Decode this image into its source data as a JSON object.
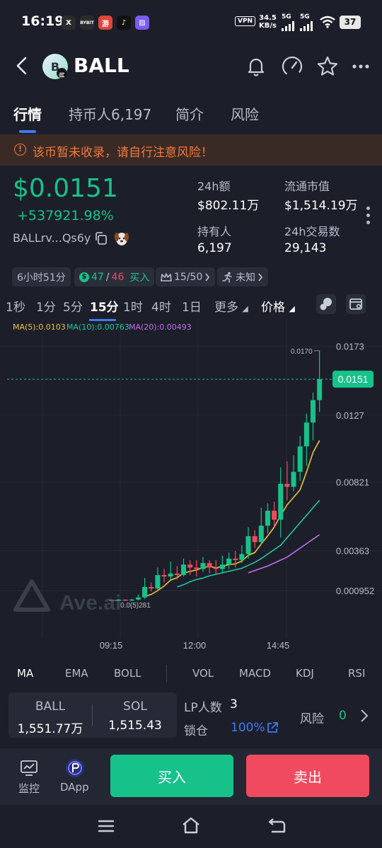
{
  "status_bar": {
    "time": "16:19",
    "apps": [
      {
        "name": "x-app-icon",
        "glyph": "X",
        "bg": "#2b2b2b"
      },
      {
        "name": "bybit-app-icon",
        "glyph": "BYBIT",
        "bg": "#2b2b2b"
      },
      {
        "name": "game-app-icon",
        "glyph": "游",
        "bg": "#e3443a"
      },
      {
        "name": "tiktok-app-icon",
        "glyph": "♪",
        "bg": "#111111"
      },
      {
        "name": "gallery-app-icon",
        "glyph": "▨",
        "bg": "#7a5cf0"
      }
    ],
    "vpn": "VPN",
    "net_speed": "34.5",
    "net_unit": "KB/s",
    "sig1": "5G",
    "sig2": "5G",
    "battery": "37"
  },
  "header": {
    "avatar_letter": "B",
    "token_name": "BALL"
  },
  "tabs": [
    {
      "label": "行情",
      "active": true
    },
    {
      "label": "持币人6,197",
      "active": false
    },
    {
      "label": "简介",
      "active": false
    },
    {
      "label": "风险",
      "active": false
    }
  ],
  "warning": {
    "icon": "!",
    "text": "该币暂未收录，请自行注意风险！"
  },
  "price": {
    "value": "$0.0151",
    "change": "+537921.98%",
    "address": "BALLrv...Qs6y"
  },
  "stats": {
    "vol24_label": "24h额",
    "vol24_value": "$802.11万",
    "mcap_label": "流通市值",
    "mcap_value": "$1,514.19万",
    "holders_label": "持有人",
    "holders_value": "6,197",
    "tx24_label": "24h交易数",
    "tx24_value": "29,143"
  },
  "pills": {
    "age": "6小时51分",
    "buy_count": "47",
    "sep": "/",
    "sell_count": "46",
    "buy_label": "买入",
    "rank": "15/50",
    "unknown": "未知"
  },
  "intervals": [
    {
      "label": "1秒",
      "active": false
    },
    {
      "label": "1分",
      "active": false
    },
    {
      "label": "5分",
      "active": false
    },
    {
      "label": "15分",
      "active": true
    },
    {
      "label": "1时",
      "active": false
    },
    {
      "label": "4时",
      "active": false
    },
    {
      "label": "1日",
      "active": false
    }
  ],
  "more_label": "更多",
  "price_label": "价格",
  "colors": {
    "up": "#17c28a",
    "down": "#f04a5e",
    "ma5": "#e9c53b",
    "ma10": "#20c9a0",
    "ma20": "#c56ce8",
    "accent": "#3e79f7"
  },
  "chart_data": {
    "type": "candlestick",
    "legend": {
      "ma5": "MA(5):0.0103",
      "ma10": "MA(10):0.00763",
      "ma20": "MA(20):0.00493"
    },
    "y_ticks": [
      "0.0173",
      "0.0127",
      "0.00821",
      "0.00363",
      "0.000952"
    ],
    "current_price": "0.0151",
    "high_marker": "0.0170",
    "low_marker": "0.0(5)281",
    "x_ticks": [
      "09:15",
      "12:00",
      "14:45"
    ],
    "watermark": "Ave.ai",
    "candles": [
      {
        "o": 0.00035,
        "c": 0.00035,
        "h": 0.00038,
        "l": 0.0003
      },
      {
        "o": 0.00035,
        "c": 0.00033,
        "h": 0.00037,
        "l": 0.0003
      },
      {
        "o": 0.00033,
        "c": 0.00036,
        "h": 0.0004,
        "l": 0.00028
      },
      {
        "o": 0.00036,
        "c": 0.0005,
        "h": 0.0007,
        "l": 0.0003
      },
      {
        "o": 0.0005,
        "c": 0.0012,
        "h": 0.0018,
        "l": 0.0004
      },
      {
        "o": 0.0012,
        "c": 0.0011,
        "h": 0.0015,
        "l": 0.0009
      },
      {
        "o": 0.0011,
        "c": 0.002,
        "h": 0.0025,
        "l": 0.001
      },
      {
        "o": 0.002,
        "c": 0.0019,
        "h": 0.0024,
        "l": 0.0015
      },
      {
        "o": 0.0019,
        "c": 0.0021,
        "h": 0.0029,
        "l": 0.0017
      },
      {
        "o": 0.0021,
        "c": 0.002,
        "h": 0.0026,
        "l": 0.0017
      },
      {
        "o": 0.002,
        "c": 0.0027,
        "h": 0.0031,
        "l": 0.0019
      },
      {
        "o": 0.0027,
        "c": 0.0025,
        "h": 0.003,
        "l": 0.002
      },
      {
        "o": 0.0025,
        "c": 0.0024,
        "h": 0.003,
        "l": 0.0019
      },
      {
        "o": 0.0024,
        "c": 0.0028,
        "h": 0.0032,
        "l": 0.0022
      },
      {
        "o": 0.0028,
        "c": 0.0025,
        "h": 0.003,
        "l": 0.0021
      },
      {
        "o": 0.0025,
        "c": 0.0024,
        "h": 0.003,
        "l": 0.002
      },
      {
        "o": 0.0024,
        "c": 0.0027,
        "h": 0.0033,
        "l": 0.0021
      },
      {
        "o": 0.0027,
        "c": 0.0031,
        "h": 0.0035,
        "l": 0.0024
      },
      {
        "o": 0.0031,
        "c": 0.003,
        "h": 0.0036,
        "l": 0.0025
      },
      {
        "o": 0.003,
        "c": 0.0034,
        "h": 0.004,
        "l": 0.0028
      },
      {
        "o": 0.0034,
        "c": 0.0046,
        "h": 0.0052,
        "l": 0.0031
      },
      {
        "o": 0.0046,
        "c": 0.0042,
        "h": 0.005,
        "l": 0.0038
      },
      {
        "o": 0.0042,
        "c": 0.0053,
        "h": 0.0065,
        "l": 0.004
      },
      {
        "o": 0.0053,
        "c": 0.0063,
        "h": 0.0068,
        "l": 0.0048
      },
      {
        "o": 0.0063,
        "c": 0.0057,
        "h": 0.0069,
        "l": 0.0052
      },
      {
        "o": 0.0057,
        "c": 0.0081,
        "h": 0.0092,
        "l": 0.0045
      },
      {
        "o": 0.0081,
        "c": 0.0079,
        "h": 0.0096,
        "l": 0.007
      },
      {
        "o": 0.0079,
        "c": 0.0089,
        "h": 0.01,
        "l": 0.0076
      },
      {
        "o": 0.0089,
        "c": 0.0106,
        "h": 0.0113,
        "l": 0.0083
      },
      {
        "o": 0.0106,
        "c": 0.0122,
        "h": 0.0128,
        "l": 0.0093
      },
      {
        "o": 0.0122,
        "c": 0.0137,
        "h": 0.0142,
        "l": 0.011
      },
      {
        "o": 0.0137,
        "c": 0.0151,
        "h": 0.017,
        "l": 0.0129
      }
    ],
    "ma5": [
      null,
      null,
      null,
      null,
      0.00058,
      0.0007,
      0.00096,
      0.00127,
      0.00166,
      0.00182,
      0.00214,
      0.00224,
      0.00234,
      0.0025,
      0.00258,
      0.00248,
      0.00258,
      0.0027,
      0.00274,
      0.00294,
      0.00332,
      0.0035,
      0.00408,
      0.00462,
      0.0052,
      0.006,
      0.0067,
      0.0072,
      0.0077,
      0.0089,
      0.0102,
      0.011
    ],
    "ma10": [
      null,
      null,
      null,
      null,
      null,
      null,
      null,
      null,
      null,
      0.0012,
      0.00135,
      0.00155,
      0.0017,
      0.0018,
      0.00195,
      0.00205,
      0.00215,
      0.00225,
      0.00235,
      0.00245,
      0.00265,
      0.00285,
      0.0031,
      0.0034,
      0.0037,
      0.004,
      0.0045,
      0.005,
      0.0055,
      0.006,
      0.0065,
      0.007
    ],
    "ma20": [
      null,
      null,
      null,
      null,
      null,
      null,
      null,
      null,
      null,
      null,
      null,
      null,
      null,
      null,
      null,
      null,
      null,
      null,
      null,
      null,
      0.00215,
      0.0023,
      0.00245,
      0.0026,
      0.0028,
      0.003,
      0.0032,
      0.0035,
      0.0038,
      0.0041,
      0.0044,
      0.0047
    ]
  },
  "indicators": {
    "main": [
      "MA",
      "EMA",
      "BOLL"
    ],
    "sub": [
      "VOL",
      "MACD",
      "KDJ",
      "RSI"
    ]
  },
  "pool": {
    "ball_label": "BALL",
    "ball_value": "1,551.77万",
    "sol_label": "SOL",
    "sol_value": "1,515.43",
    "lp_label": "LP人数",
    "lp_value": "3",
    "lock_label": "锁仓",
    "lock_value": "100%",
    "risk_label": "风险",
    "risk_value": "0"
  },
  "bottom": {
    "monitor_label": "监控",
    "dapp_label": "DApp",
    "buy_label": "买入",
    "sell_label": "卖出"
  }
}
